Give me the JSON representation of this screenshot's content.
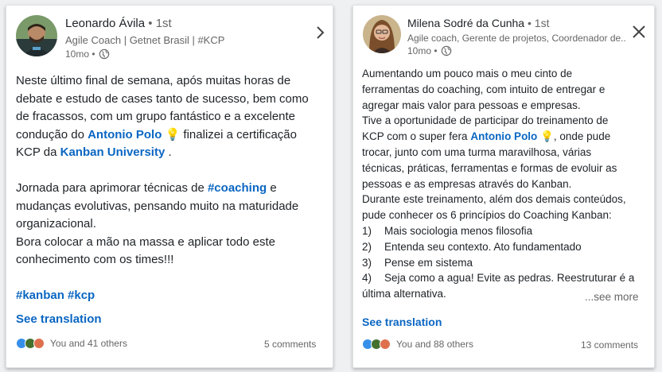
{
  "colors": {
    "link": "#0a66c2",
    "text": "#1d2226",
    "muted": "#666666",
    "like": "#378fe9",
    "celebrate": "#44712e",
    "love": "#df704d"
  },
  "post1": {
    "author": "Leonardo Ávila",
    "separator": "•",
    "degree": "1st",
    "headline": "Agile Coach | Getnet Brasil | #KCP",
    "time": "10mo •",
    "visibility_icon": "globe-icon",
    "control_icon": "chevron-right-icon",
    "body": {
      "l1": "Neste último final de semana, após muitas horas de",
      "l2": "debate e estudo de cases tanto de sucesso, bem como",
      "l3": "de fracassos, com um grupo fantástico e a excelente",
      "l4_pre": "condução do",
      "l4_mention": "Antonio Polo",
      "l4_emoji": "💡",
      "l4_post": "finalizei a certificação",
      "l5_pre": "KCP da",
      "l5_mention": "Kanban University",
      "l5_post": ".",
      "l7_pre": "Jornada para aprimorar técnicas de",
      "l7_tag": "#coaching",
      "l7_post": "e",
      "l8": "mudanças evolutivas, pensando muito na maturidade",
      "l9": "organizacional.",
      "l10": "Bora colocar a mão na massa e aplicar todo este",
      "l11": "conhecimento com os times!!!",
      "hashtags": "#kanban #kcp"
    },
    "see_translation": "See translation",
    "reactions": "You and 41 others",
    "comments": "5 comments"
  },
  "post2": {
    "author": "Milena Sodré da Cunha",
    "separator": "•",
    "degree": "1st",
    "headline": "Agile coach, Gerente de projetos, Coordenador de...",
    "time": "10mo •",
    "visibility_icon": "globe-icon",
    "control_icon": "close-icon",
    "body": {
      "l1": "Aumentando um pouco mais o meu cinto de",
      "l2": "ferramentas do coaching, com intuito de entregar e",
      "l3": "agregar mais valor para pessoas e empresas.",
      "l4": "Tive a oportunidade de participar do treinamento de",
      "l5_pre": "KCP com o super fera",
      "l5_mention": "Antonio Polo",
      "l5_emoji": "💡",
      "l5_post": ", onde pude",
      "l6": "trocar, junto com uma turma maravilhosa, várias",
      "l7": "técnicas, práticas, ferramentas e formas de evoluir as",
      "l8": "pessoas e as empresas através do Kanban.",
      "l9": "Durante este treinamento, além dos demais conteúdos,",
      "l10": "pude conhecer os 6 princípios do Coaching Kanban:",
      "items": [
        {
          "num": "1)",
          "text": "Mais sociologia menos filosofia"
        },
        {
          "num": "2)",
          "text": "Entenda seu contexto. Ato fundamentado"
        },
        {
          "num": "3)",
          "text": "Pense em sistema"
        },
        {
          "num": "4)",
          "text": "Seja como a agua! Evite as pedras. Reestruturar é a"
        }
      ],
      "last": "última alternativa.",
      "see_more": "...see more"
    },
    "see_translation": "See translation",
    "reactions": "You and 88 others",
    "comments": "13 comments"
  }
}
